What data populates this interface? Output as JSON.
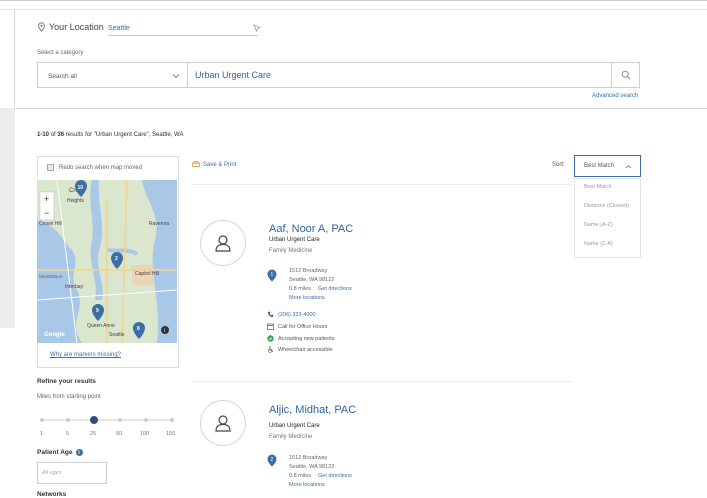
{
  "location": {
    "label": "Your Location",
    "value": "Seattle"
  },
  "category": {
    "label": "Select a category",
    "selected": "Search all"
  },
  "search": {
    "value": "Urban Urgent Care",
    "advanced_label": "Advanced search"
  },
  "results": {
    "range": "1-10",
    "of_word": "of",
    "total": "36",
    "suffix": "results for",
    "query": "\"Urban Urgent Care\", Seattle, WA"
  },
  "map": {
    "redo_label": "Redo search when map moved",
    "why_link": "Why are markers missing?",
    "zoom_in": "+",
    "zoom_out": "−",
    "place_labels": [
      "Cro",
      "Heights",
      "Crown Hill",
      "Ravenna",
      "Interbay",
      "Queen Anne",
      "MAGNOLIA",
      "Capitol Hill",
      "Google",
      "Seattle"
    ],
    "markers": [
      "10",
      "2",
      "9",
      "8"
    ]
  },
  "filters": {
    "refine_title": "Refine your results",
    "miles_label": "Miles from starting point",
    "miles_ticks": [
      "1",
      "5",
      "25",
      "50",
      "100",
      "150"
    ],
    "miles_selected": "25",
    "patient_age_label": "Patient Age",
    "patient_age_placeholder": "All ages",
    "networks_label": "Networks"
  },
  "toolbar": {
    "save_print": "Save & Print",
    "sort_label": "Sort:",
    "sort_selected": "Best Match"
  },
  "sort_options": [
    "Best Match",
    "Distance (Closest)",
    "Name (A-Z)",
    "Name (Z-A)"
  ],
  "providers": [
    {
      "name": "Aaf, Noor A, PAC",
      "org": "Urban Urgent Care",
      "specialty": "Family Medicine",
      "marker": "1",
      "address1": "1512 Broadway",
      "address2": "Seattle, WA 98122",
      "distance": "0.8 miles",
      "directions": "Get directions",
      "more_locations": "More locations",
      "phone": "(206) 323-4000",
      "hours": "Call for Office Hours",
      "accepting": "Accepting new patients",
      "accessible": "Wheelchair accessible"
    },
    {
      "name": "Aljic, Midhat, PAC",
      "org": "Urban Urgent Care",
      "specialty": "Family Medicine",
      "marker": "2",
      "address1": "1512 Broadway",
      "address2": "Seattle, WA 98122",
      "distance": "0.8 miles",
      "directions": "Get directions",
      "more_locations": "More locations"
    }
  ],
  "colors": {
    "accent": "#2f64a3",
    "marker": "#3a6ea5",
    "accepting": "#3aa65a"
  }
}
